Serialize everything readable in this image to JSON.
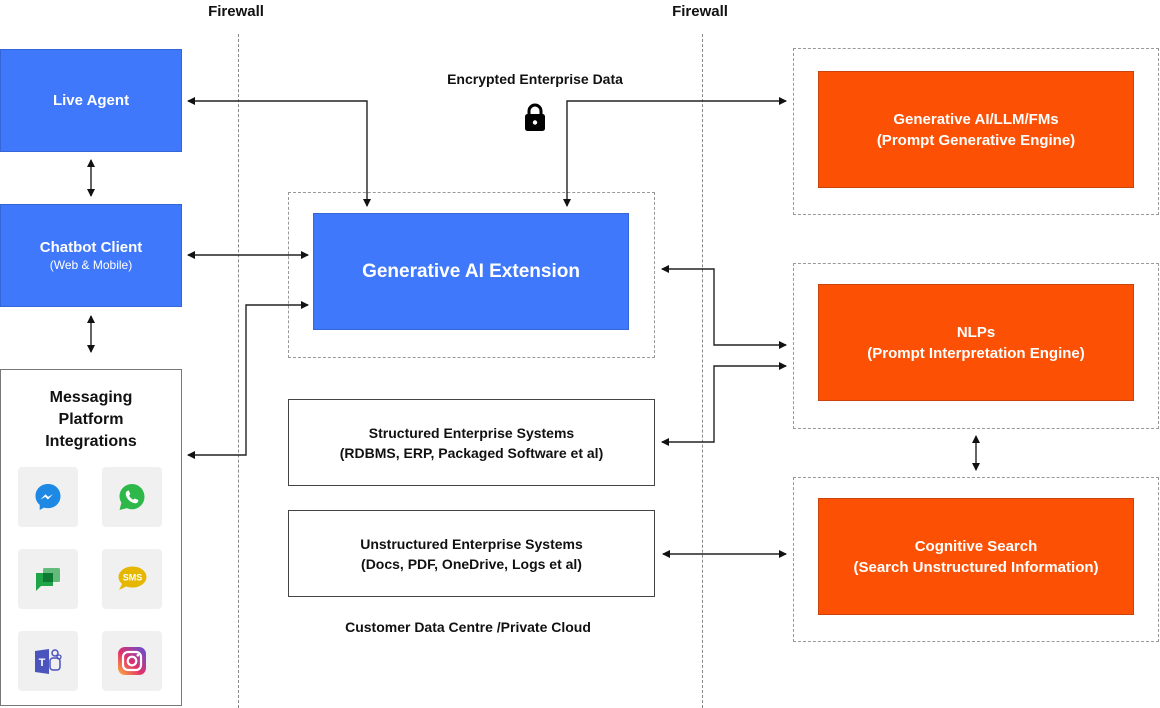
{
  "firewalls": [
    {
      "label": "Firewall"
    },
    {
      "label": "Firewall"
    }
  ],
  "left": {
    "live_agent": {
      "title": "Live Agent"
    },
    "chatbot_client": {
      "title": "Chatbot Client",
      "subtitle": "(Web & Mobile)"
    },
    "messaging": {
      "title_lines": [
        "Messaging",
        "Platform",
        "Integrations"
      ],
      "icons": [
        {
          "name": "messenger-icon",
          "color": "#1e88e5"
        },
        {
          "name": "whatsapp-icon",
          "color": "#2fb84a"
        },
        {
          "name": "google-chat-icon",
          "color": "#1fa448"
        },
        {
          "name": "sms-icon",
          "label": "SMS",
          "color": "#e5b700"
        },
        {
          "name": "teams-icon",
          "label": "T",
          "color": "#4b53bc"
        },
        {
          "name": "instagram-icon",
          "color": "#e1306c"
        }
      ]
    }
  },
  "center": {
    "encrypted_label": "Encrypted Enterprise Data",
    "extension": {
      "title": "Generative AI Extension"
    },
    "structured": {
      "title": "Structured Enterprise Systems",
      "subtitle": "(RDBMS, ERP, Packaged Software et al)"
    },
    "unstructured": {
      "title": "Unstructured Enterprise Systems",
      "subtitle": "(Docs, PDF, OneDrive, Logs et al)"
    },
    "footer": "Customer Data Centre /Private Cloud"
  },
  "right": {
    "genai": {
      "title": "Generative AI/LLM/FMs",
      "subtitle": "(Prompt Generative Engine)"
    },
    "nlp": {
      "title": "NLPs",
      "subtitle": "(Prompt Interpretation Engine)"
    },
    "search": {
      "title": "Cognitive Search",
      "subtitle": "(Search Unstructured Information)"
    }
  },
  "colors": {
    "blue": "#3f78fb",
    "orange": "#fc5004",
    "tile_bg": "#f0f0f0"
  }
}
